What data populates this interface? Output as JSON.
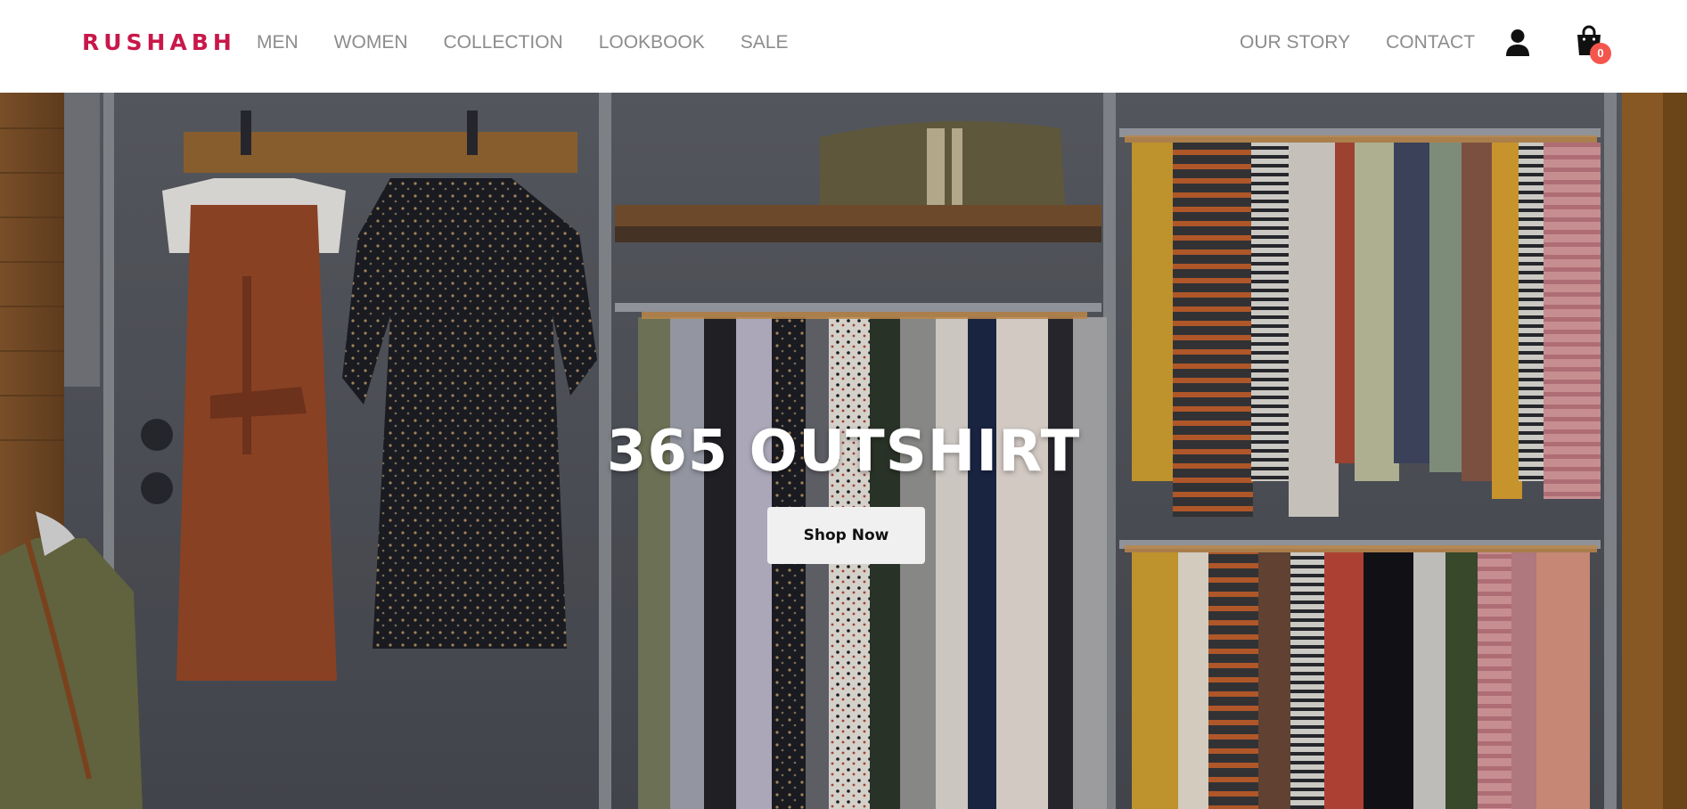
{
  "brand": {
    "logo_text": "RUSHABH",
    "color": "#c8184a"
  },
  "nav": {
    "left": [
      {
        "label": "MEN"
      },
      {
        "label": "WOMEN"
      },
      {
        "label": "COLLECTION"
      },
      {
        "label": "LOOKBOOK"
      },
      {
        "label": "SALE"
      }
    ],
    "right": [
      {
        "label": "OUR STORY"
      },
      {
        "label": "CONTACT"
      }
    ],
    "link_color": "#8c8c8c"
  },
  "icons": {
    "account": "user-icon",
    "cart": "shopping-bag-icon"
  },
  "cart": {
    "count": "0",
    "badge_color": "#f4564d"
  },
  "hero": {
    "title": "365 OUTSHIRT",
    "cta_label": "Shop Now",
    "image": "clothing-store-racks-photo"
  }
}
